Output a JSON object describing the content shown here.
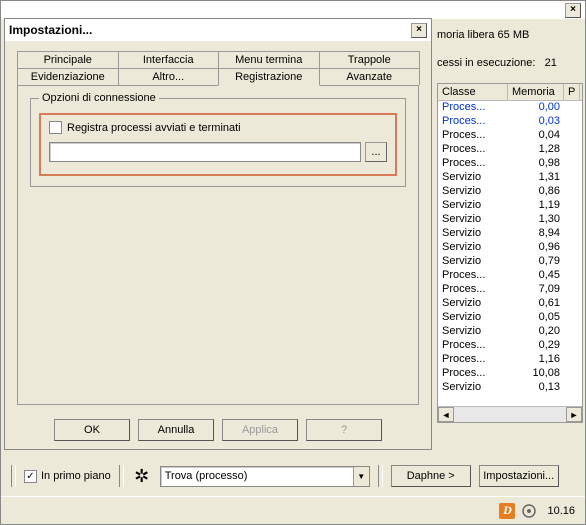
{
  "main": {
    "close": "×",
    "mem_free": "moria libera 65 MB",
    "proc_running_label": "cessi in esecuzione:",
    "proc_running_count": "21"
  },
  "dialog": {
    "title": "Impostazioni...",
    "close": "×",
    "tabs_row1": [
      "Principale",
      "Interfaccia",
      "Menu termina",
      "Trappole"
    ],
    "tabs_row2": [
      "Evidenziazione",
      "Altro...",
      "Registrazione",
      "Avanzate"
    ],
    "fieldset_legend": "Opzioni di connessione",
    "checkbox_label": "Registra processi avviati e terminati",
    "browse_label": "...",
    "buttons": {
      "ok": "OK",
      "cancel": "Annulla",
      "apply": "Applica",
      "help": "?"
    }
  },
  "table": {
    "headers": {
      "class": "Classe",
      "memory": "Memoria",
      "p": "P"
    },
    "rows": [
      {
        "c": "Proces...",
        "m": "0,00",
        "blue": true
      },
      {
        "c": "Proces...",
        "m": "0,03",
        "blue": true
      },
      {
        "c": "Proces...",
        "m": "0,04"
      },
      {
        "c": "Proces...",
        "m": "1,28"
      },
      {
        "c": "Proces...",
        "m": "0,98"
      },
      {
        "c": "Servizio",
        "m": "1,31"
      },
      {
        "c": "Servizio",
        "m": "0,86"
      },
      {
        "c": "Servizio",
        "m": "1,19"
      },
      {
        "c": "Servizio",
        "m": "1,30"
      },
      {
        "c": "Servizio",
        "m": "8,94"
      },
      {
        "c": "Servizio",
        "m": "0,96"
      },
      {
        "c": "Servizio",
        "m": "0,79"
      },
      {
        "c": "Proces...",
        "m": "0,45"
      },
      {
        "c": "Proces...",
        "m": "7,09"
      },
      {
        "c": "Servizio",
        "m": "0,61"
      },
      {
        "c": "Servizio",
        "m": "0,05"
      },
      {
        "c": "Servizio",
        "m": "0,20"
      },
      {
        "c": "Proces...",
        "m": "0,29"
      },
      {
        "c": "Proces...",
        "m": "1,16"
      },
      {
        "c": "Proces...",
        "m": "10,08"
      },
      {
        "c": "Servizio",
        "m": "0,13"
      }
    ]
  },
  "bottom": {
    "in_primo_piano": "In primo piano",
    "crosshair": "✲",
    "combo_value": "Trova (processo)",
    "daphne": "Daphne >",
    "impostazioni": "Impostazioni..."
  },
  "taskbar": {
    "d": "D",
    "clock": "10.16"
  }
}
